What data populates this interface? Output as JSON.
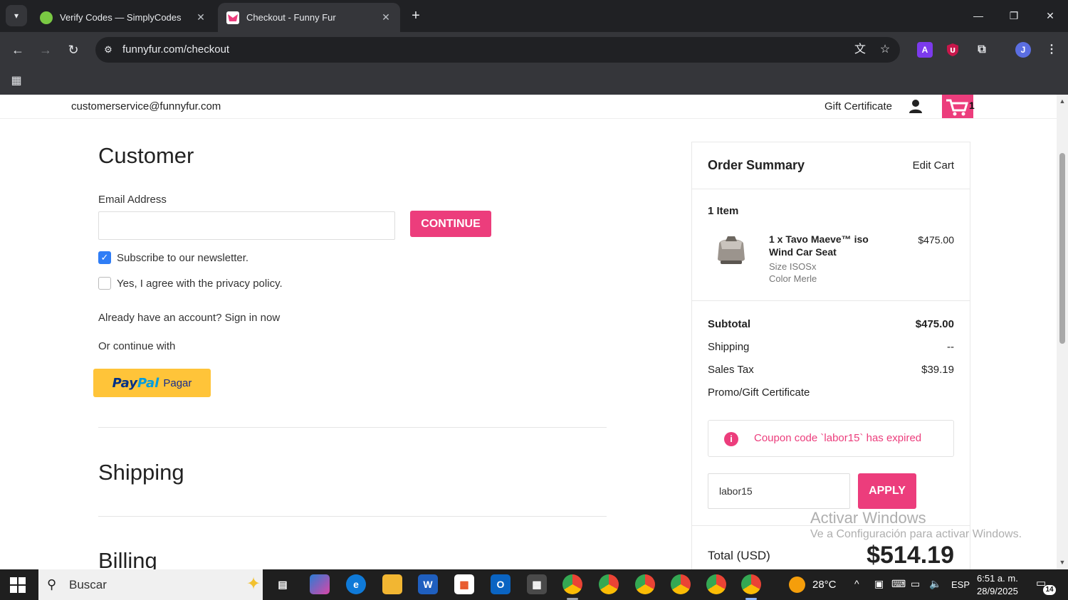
{
  "browser": {
    "tabs": [
      {
        "title": "Verify Codes — SimplyCodes",
        "icon": "simplycodes-favicon",
        "active": false
      },
      {
        "title": "Checkout - Funny Fur",
        "icon": "funnyfur-favicon",
        "active": true
      }
    ],
    "url": "funnyfur.com/checkout",
    "profile_initial": "J"
  },
  "site_header": {
    "contact_email": "customerservice@funnyfur.com",
    "gift_certificate": "Gift Certificate",
    "cart_count": "1"
  },
  "customer": {
    "heading": "Customer",
    "email_label": "Email Address",
    "email_value": "",
    "continue_button": "CONTINUE",
    "newsletter_label": "Subscribe to our newsletter.",
    "newsletter_checked": true,
    "privacy_label": "Yes, I agree with the privacy policy.",
    "privacy_checked": false,
    "account_text": "Already have an account? Sign in now",
    "continue_with": "Or continue with",
    "paypal_pay": "PayPal",
    "paypal_label": "Pagar"
  },
  "sections": {
    "shipping": "Shipping",
    "billing": "Billing"
  },
  "order_summary": {
    "title": "Order Summary",
    "edit_cart": "Edit Cart",
    "item_count": "1 Item",
    "item": {
      "name_line1": "1 x Tavo Maeve™ iso",
      "name_line2": "Wind Car Seat",
      "size": "Size ISOSx",
      "color": "Color Merle",
      "price": "$475.00"
    },
    "rows": [
      {
        "label": "Subtotal",
        "value": "$475.00",
        "bold": true
      },
      {
        "label": "Shipping",
        "value": "--",
        "bold": false
      },
      {
        "label": "Sales Tax",
        "value": "$39.19",
        "bold": false
      },
      {
        "label": "Promo/Gift Certificate",
        "value": "",
        "bold": false
      }
    ],
    "coupon_alert": "Coupon code `labor15` has expired",
    "coupon_value": "labor15",
    "apply_button": "APPLY",
    "total_label": "Total (USD)",
    "total_value": "$514.19"
  },
  "watermark": {
    "line1": "Activar Windows",
    "line2": "Ve a Configuración para activar Windows."
  },
  "taskbar": {
    "search_placeholder": "Buscar",
    "weather": "28°C",
    "language": "ESP",
    "time": "6:51 a. m.",
    "date": "28/9/2025",
    "notifications": "14"
  },
  "colors": {
    "accent_pink": "#ec3d7c",
    "paypal_yellow": "#ffc439",
    "chrome_dark": "#202124"
  }
}
